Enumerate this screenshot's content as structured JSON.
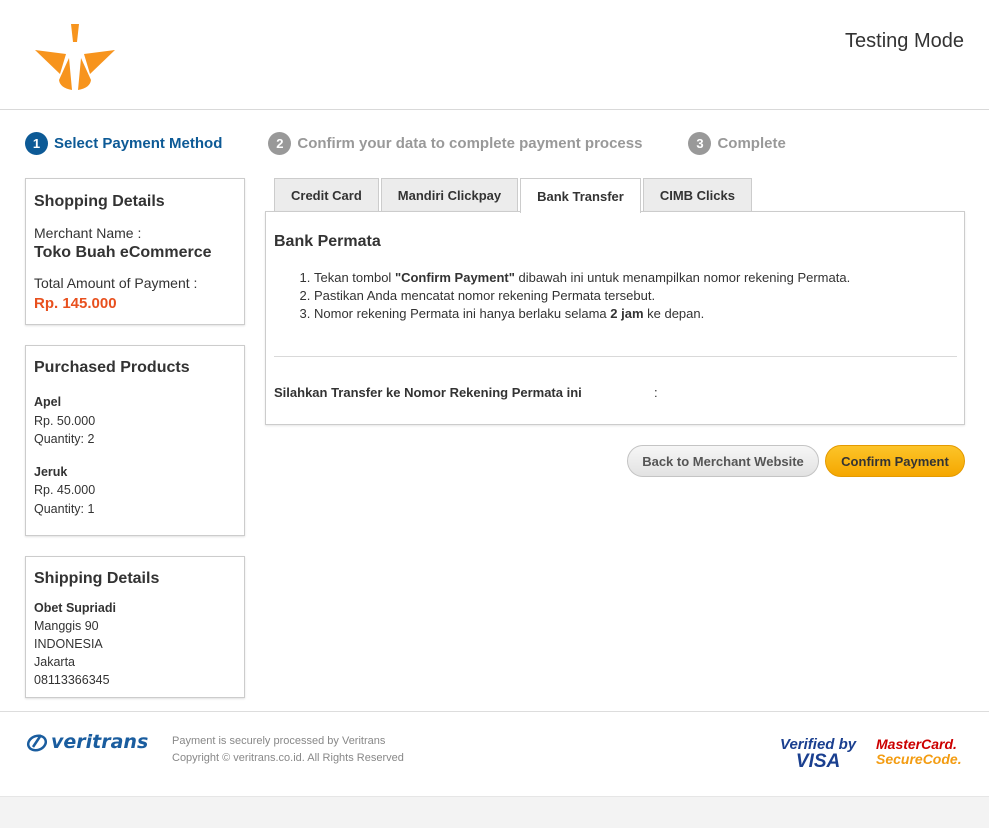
{
  "header": {
    "mode_label": "Testing Mode",
    "brand_color": "#f7941d"
  },
  "steps": [
    {
      "number": "1",
      "label": "Select Payment Method"
    },
    {
      "number": "2",
      "label": "Confirm your data to complete payment process"
    },
    {
      "number": "3",
      "label": "Complete"
    }
  ],
  "shopping": {
    "title": "Shopping Details",
    "merchant_label": "Merchant Name :",
    "merchant_name": "Toko Buah eCommerce",
    "total_label": "Total Amount of Payment :",
    "total_amount": "Rp. 145.000"
  },
  "products": {
    "title": "Purchased Products",
    "items": [
      {
        "name": "Apel",
        "price": "Rp. 50.000",
        "quantity": "Quantity: 2"
      },
      {
        "name": "Jeruk",
        "price": "Rp. 45.000",
        "quantity": "Quantity: 1"
      }
    ]
  },
  "shipping": {
    "title": "Shipping Details",
    "name": "Obet Supriadi",
    "address": "Manggis 90",
    "country": "INDONESIA",
    "city": "Jakarta",
    "phone": "08113366345"
  },
  "tabs": [
    {
      "label": "Credit Card"
    },
    {
      "label": "Mandiri Clickpay"
    },
    {
      "label": "Bank Transfer"
    },
    {
      "label": "CIMB Clicks"
    }
  ],
  "bank": {
    "title": "Bank Permata",
    "step1_pre": "Tekan tombol ",
    "step1_bold": "\"Confirm Payment\"",
    "step1_post": " dibawah ini untuk menampilkan nomor rekening Permata.",
    "step2": "Pastikan Anda mencatat nomor rekening Permata tersebut.",
    "step3_pre": "Nomor rekening Permata ini hanya berlaku selama ",
    "step3_bold": "2 jam",
    "step3_post": " ke depan.",
    "transfer_label": "Silahkan Transfer ke Nomor Rekening Permata ini",
    "colon": ":"
  },
  "buttons": {
    "back": "Back to Merchant Website",
    "confirm": "Confirm Payment"
  },
  "footer": {
    "brand": "veritrans",
    "line1": "Payment is securely processed by Veritrans",
    "line2": "Copyright © veritrans.co.id. All Rights Reserved",
    "vbv_line1": "Verified by",
    "vbv_line2": "VISA",
    "mc_line1": "MasterCard.",
    "mc_line2": "SecureCode."
  }
}
